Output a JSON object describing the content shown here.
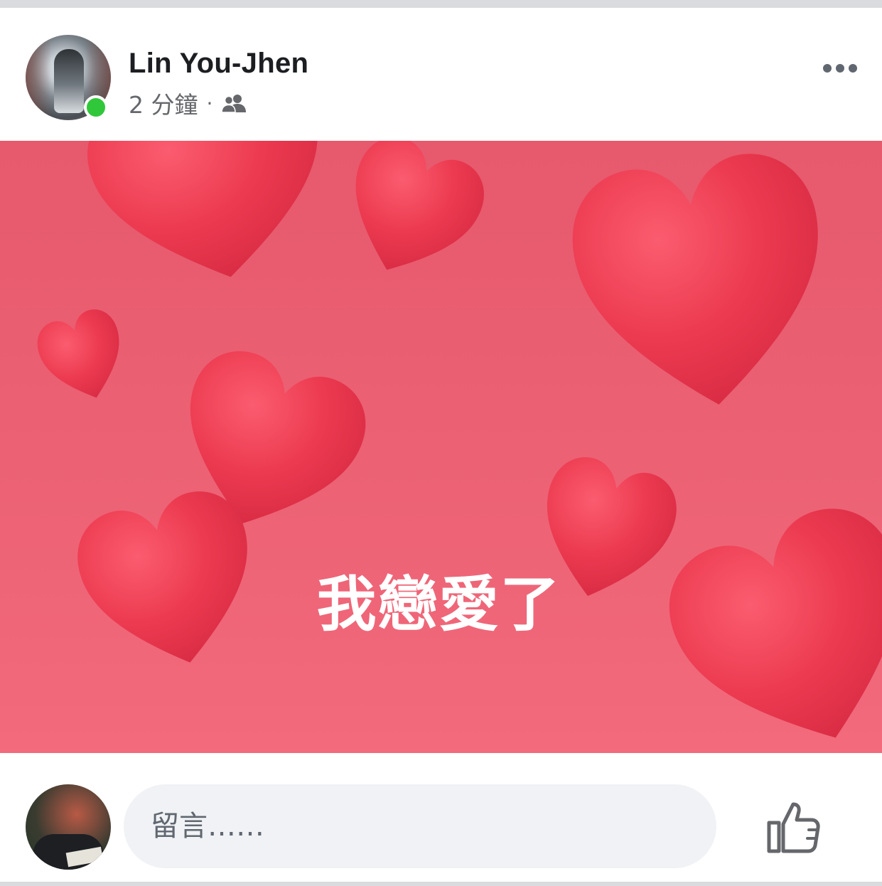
{
  "post": {
    "author_name": "Lin You-Jhen",
    "time_ago": "2 分鐘",
    "separator": "·",
    "audience_icon": "friends-icon",
    "more_icon": "more-horizontal-icon",
    "online": true
  },
  "banner": {
    "text": "我戀愛了",
    "background_color": "#ec6174",
    "heart_color": "#ea3b52"
  },
  "comment": {
    "placeholder": "留言……",
    "like_icon": "thumbs-up-icon"
  },
  "colors": {
    "online": "#31c73a",
    "name": "#1c1e21",
    "meta": "#65676b",
    "input_bg": "#f0f2f5"
  }
}
